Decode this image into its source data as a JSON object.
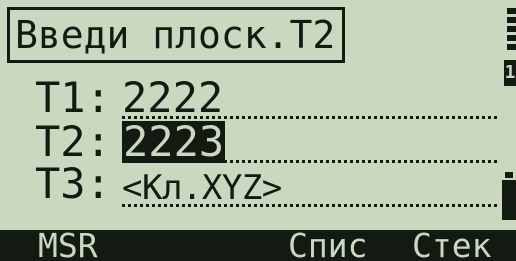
{
  "prompt": {
    "title": "Введи плоск.T2"
  },
  "fields": [
    {
      "label": "T1:",
      "value": "2222"
    },
    {
      "label": "T2:",
      "value": "2223"
    },
    {
      "label": "T3:",
      "value": "<Кл.XYZ>"
    }
  ],
  "status": {
    "face": "1",
    "top_icon": "signal-icon",
    "battery_icon": "battery-icon"
  },
  "softkeys": {
    "msr": "MSR",
    "list": "Спис",
    "stack": "Стек"
  },
  "colors": {
    "background": "#c9d8be",
    "foreground": "#131a12"
  }
}
